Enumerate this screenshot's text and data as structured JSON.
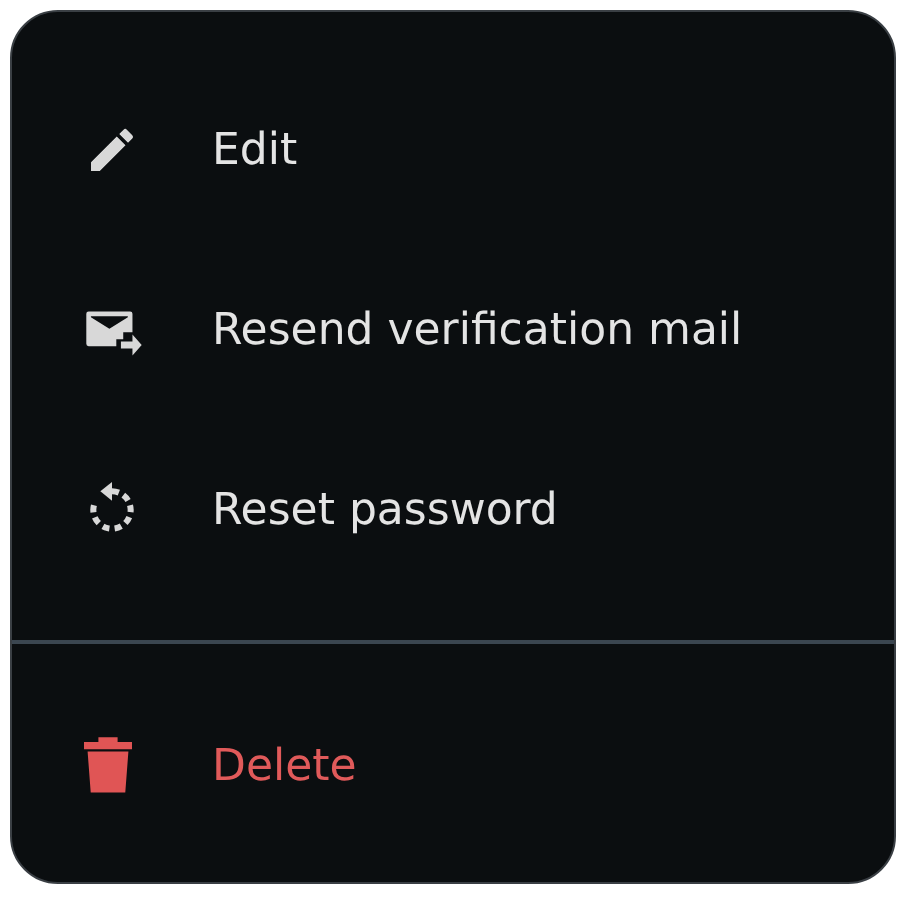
{
  "menu": {
    "sections": [
      [
        {
          "label": "Edit",
          "kind": "normal"
        },
        {
          "label": "Resend verification mail",
          "kind": "normal"
        },
        {
          "label": "Reset password",
          "kind": "normal"
        }
      ],
      [
        {
          "label": "Delete",
          "kind": "danger"
        }
      ]
    ]
  }
}
